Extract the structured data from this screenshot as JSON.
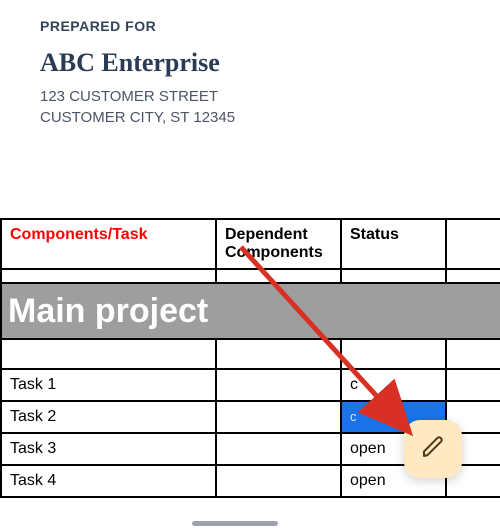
{
  "header": {
    "prepared_for_label": "PREPARED FOR",
    "company_name": "ABC Enterprise",
    "address_line1": "123 CUSTOMER STREET",
    "address_line2": "CUSTOMER CITY, ST 12345"
  },
  "table": {
    "headers": {
      "components": "Components/Task",
      "dependent": "Dependent Components",
      "status": "Status"
    },
    "project_title": "Main project",
    "rows": [
      {
        "task": "Task 1",
        "status": "c"
      },
      {
        "task": "Task 2",
        "status_sel": "c"
      },
      {
        "task": "Task 3",
        "status": "open"
      },
      {
        "task": "Task 4",
        "status": "open"
      }
    ]
  },
  "icons": {
    "edit": "pencil-icon"
  },
  "colors": {
    "header_text": "#33445a",
    "company_text": "#2b3a55",
    "red_header": "#ff0000",
    "project_bg": "#9e9e9e",
    "selection": "#1a73e8",
    "fab_bg": "#ffe8c2",
    "arrow": "#d93025"
  }
}
